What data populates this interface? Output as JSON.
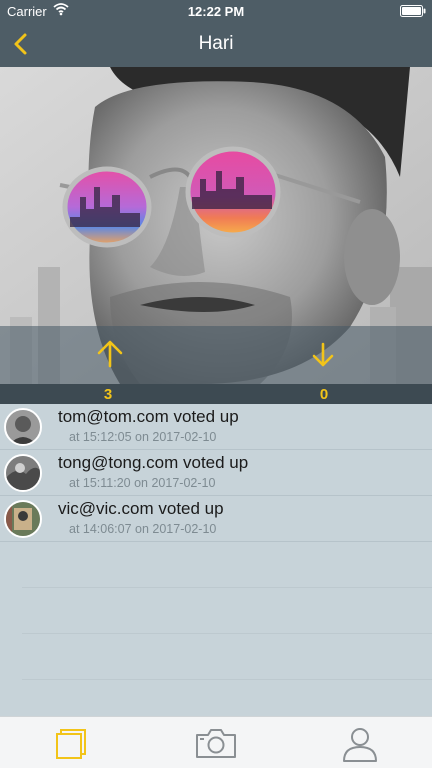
{
  "status_bar": {
    "carrier": "Carrier",
    "time": "12:22 PM"
  },
  "nav": {
    "title": "Hari",
    "back_icon": "chevron-left-icon"
  },
  "votes": {
    "up_count": "3",
    "down_count": "0"
  },
  "activity": [
    {
      "user": "tom@tom.com",
      "action": "voted up",
      "main_text": "tom@tom.com voted up",
      "detail": "at 15:12:05 on 2017-02-10"
    },
    {
      "user": "tong@tong.com",
      "action": "voted up",
      "main_text": "tong@tong.com voted up",
      "detail": "at 15:11:20 on 2017-02-10"
    },
    {
      "user": "vic@vic.com",
      "action": "voted up",
      "main_text": "vic@vic.com voted up",
      "detail": "at 14:06:07 on 2017-02-10"
    }
  ],
  "tabs": [
    {
      "name": "feed",
      "icon": "stacked-squares-icon",
      "selected": true
    },
    {
      "name": "camera",
      "icon": "camera-icon",
      "selected": false
    },
    {
      "name": "profile",
      "icon": "person-icon",
      "selected": false
    }
  ],
  "colors": {
    "accent": "#f2c419",
    "nav_background": "#4e5d66",
    "list_background": "#c7d3d9",
    "count_bar": "#3d4a52"
  }
}
